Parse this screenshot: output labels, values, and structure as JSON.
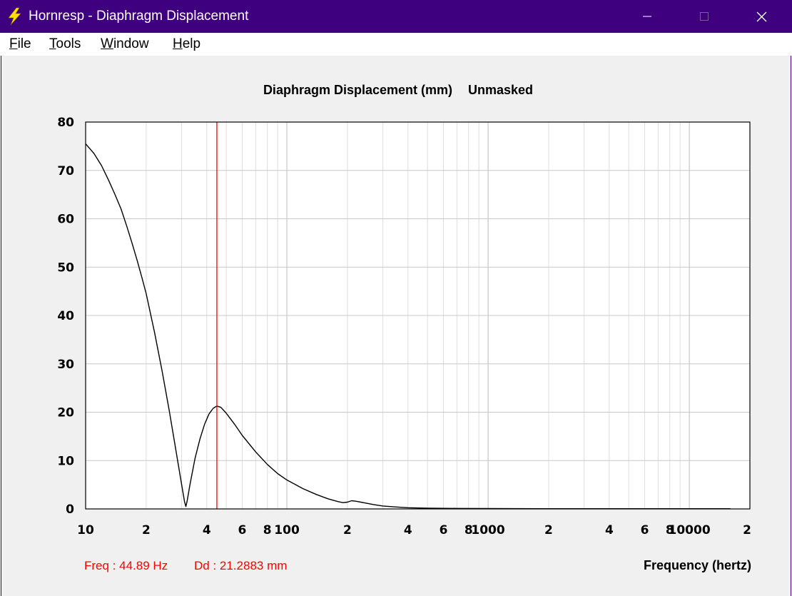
{
  "window": {
    "title": "Hornresp - Diaphragm Displacement",
    "controls": {
      "minimize": "minimize",
      "maximize": "maximize",
      "close": "close"
    }
  },
  "menu": {
    "items": [
      {
        "mnemonic": "F",
        "rest": "ile"
      },
      {
        "mnemonic": "T",
        "rest": "ools"
      },
      {
        "mnemonic": "W",
        "rest": "indow"
      },
      {
        "mnemonic": "H",
        "rest": "elp"
      }
    ]
  },
  "readout": {
    "freq": "Freq : 44.89 Hz",
    "dd": "Dd : 21.2883 mm",
    "color": "#ff0000"
  },
  "chart_data": {
    "type": "line",
    "title": "Diaphragm Displacement (mm)",
    "subtitle": "Unmasked",
    "xlabel": "Frequency (hertz)",
    "ylabel": "",
    "x_scale": "log",
    "xlim": [
      10,
      20000
    ],
    "ylim": [
      0,
      80
    ],
    "grid": true,
    "y_ticks": [
      0,
      10,
      20,
      30,
      40,
      50,
      60,
      70,
      80
    ],
    "y_tick_labels": [
      "0",
      "10",
      "20",
      "30",
      "40",
      "50",
      "60",
      "70",
      "80"
    ],
    "x_ticks": [
      10,
      20,
      40,
      60,
      80,
      100,
      200,
      400,
      600,
      800,
      1000,
      2000,
      4000,
      6000,
      8000,
      10000,
      20000
    ],
    "x_tick_labels": [
      "10",
      "2",
      "4",
      "6",
      "8",
      "100",
      "2",
      "4",
      "6",
      "8",
      "1000",
      "2",
      "4",
      "6",
      "8",
      "10000",
      "2"
    ],
    "cursor": {
      "x": 44.89,
      "y": 21.2883,
      "color": "#ff0000"
    },
    "series": [
      {
        "color": "#000000",
        "points": [
          [
            10,
            75.5
          ],
          [
            11,
            73.5
          ],
          [
            12,
            71
          ],
          [
            13,
            68
          ],
          [
            14,
            65
          ],
          [
            15,
            62
          ],
          [
            16,
            58.5
          ],
          [
            17,
            55
          ],
          [
            18,
            51.5
          ],
          [
            19,
            48
          ],
          [
            20,
            44.5
          ],
          [
            22,
            36.5
          ],
          [
            24,
            28.5
          ],
          [
            26,
            20.5
          ],
          [
            28,
            12.5
          ],
          [
            30,
            5
          ],
          [
            31,
            1.5
          ],
          [
            31.5,
            0.5
          ],
          [
            32,
            1.8
          ],
          [
            33,
            5
          ],
          [
            35,
            10.5
          ],
          [
            37,
            14.5
          ],
          [
            39,
            17.5
          ],
          [
            41,
            19.6
          ],
          [
            43,
            20.8
          ],
          [
            44.89,
            21.29
          ],
          [
            47,
            21
          ],
          [
            50,
            19.8
          ],
          [
            55,
            17.5
          ],
          [
            60,
            15.2
          ],
          [
            70,
            11.8
          ],
          [
            80,
            9.2
          ],
          [
            90,
            7.3
          ],
          [
            100,
            6
          ],
          [
            120,
            4.2
          ],
          [
            140,
            3
          ],
          [
            160,
            2.1
          ],
          [
            180,
            1.5
          ],
          [
            190,
            1.3
          ],
          [
            200,
            1.4
          ],
          [
            210,
            1.7
          ],
          [
            220,
            1.6
          ],
          [
            240,
            1.3
          ],
          [
            270,
            0.9
          ],
          [
            300,
            0.6
          ],
          [
            350,
            0.4
          ],
          [
            400,
            0.25
          ],
          [
            500,
            0.15
          ],
          [
            700,
            0.1
          ],
          [
            1000,
            0.07
          ],
          [
            2000,
            0.05
          ],
          [
            5000,
            0.04
          ],
          [
            10000,
            0.04
          ],
          [
            16000,
            0.04
          ]
        ]
      }
    ]
  }
}
